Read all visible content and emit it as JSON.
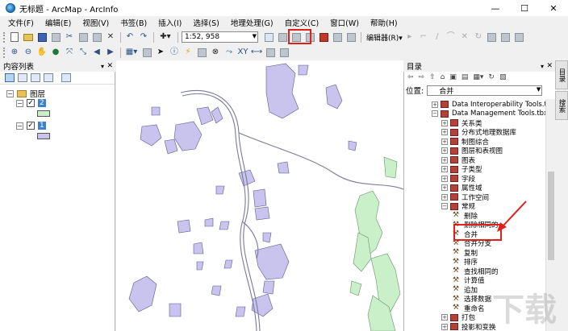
{
  "window": {
    "title": "无标题 - ArcMap - ArcInfo",
    "minimize": "—",
    "maximize": "☐",
    "close": "✕"
  },
  "menu": [
    "文件(F)",
    "编辑(E)",
    "视图(V)",
    "书签(B)",
    "插入(I)",
    "选择(S)",
    "地理处理(G)",
    "自定义(C)",
    "窗口(W)",
    "帮助(H)"
  ],
  "toolbar": {
    "scale_value": "1:52, 958",
    "editor_label": "编辑器(R)▾"
  },
  "toc": {
    "title": "内容列表",
    "group_label": "图层",
    "layers": [
      {
        "name": "2",
        "checked": true,
        "color": "#c9f0c9"
      },
      {
        "name": "1",
        "checked": true,
        "color": "#c8c4ee"
      }
    ]
  },
  "catalog": {
    "title": "目录",
    "location_label": "位置:",
    "location_value": "合并",
    "items": [
      {
        "label": "Data Interoperability Tools.tbx",
        "kind": "toolbox",
        "indent": 0,
        "expander": "+"
      },
      {
        "label": "Data Management Tools.tbx",
        "kind": "toolbox",
        "indent": 0,
        "expander": "−"
      },
      {
        "label": "关系类",
        "kind": "toolset",
        "indent": 1,
        "expander": "+"
      },
      {
        "label": "分布式地理数据库",
        "kind": "toolset",
        "indent": 1,
        "expander": "+"
      },
      {
        "label": "制图综合",
        "kind": "toolset",
        "indent": 1,
        "expander": "+"
      },
      {
        "label": "图层和表视图",
        "kind": "toolset",
        "indent": 1,
        "expander": "+"
      },
      {
        "label": "图表",
        "kind": "toolset",
        "indent": 1,
        "expander": "+"
      },
      {
        "label": "子类型",
        "kind": "toolset",
        "indent": 1,
        "expander": "+"
      },
      {
        "label": "字段",
        "kind": "toolset",
        "indent": 1,
        "expander": "+"
      },
      {
        "label": "属性域",
        "kind": "toolset",
        "indent": 1,
        "expander": "+"
      },
      {
        "label": "工作空间",
        "kind": "toolset",
        "indent": 1,
        "expander": "+"
      },
      {
        "label": "常规",
        "kind": "toolset",
        "indent": 1,
        "expander": "−"
      },
      {
        "label": "删除",
        "kind": "tool",
        "indent": 2,
        "expander": ""
      },
      {
        "label": "删除相同的",
        "kind": "tool",
        "indent": 2,
        "expander": ""
      },
      {
        "label": "合并",
        "kind": "tool",
        "indent": 2,
        "expander": ""
      },
      {
        "label": "合并分支",
        "kind": "tool",
        "indent": 2,
        "expander": ""
      },
      {
        "label": "复制",
        "kind": "tool",
        "indent": 2,
        "expander": ""
      },
      {
        "label": "排序",
        "kind": "tool",
        "indent": 2,
        "expander": ""
      },
      {
        "label": "查找相同的",
        "kind": "tool",
        "indent": 2,
        "expander": ""
      },
      {
        "label": "计算值",
        "kind": "tool",
        "indent": 2,
        "expander": ""
      },
      {
        "label": "追加",
        "kind": "tool",
        "indent": 2,
        "expander": ""
      },
      {
        "label": "选择数据",
        "kind": "tool",
        "indent": 2,
        "expander": ""
      },
      {
        "label": "重命名",
        "kind": "tool",
        "indent": 2,
        "expander": ""
      },
      {
        "label": "打包",
        "kind": "toolset",
        "indent": 1,
        "expander": "+"
      },
      {
        "label": "投影和变换",
        "kind": "toolset",
        "indent": 1,
        "expander": "+"
      }
    ]
  },
  "side_tabs": [
    "目录",
    "搜索"
  ],
  "watermark": "下载",
  "colors": {
    "layer1": "#c8c4ee",
    "layer2": "#c9f0c9",
    "highlight": "#e0201b",
    "river": "#7a7a9a"
  }
}
